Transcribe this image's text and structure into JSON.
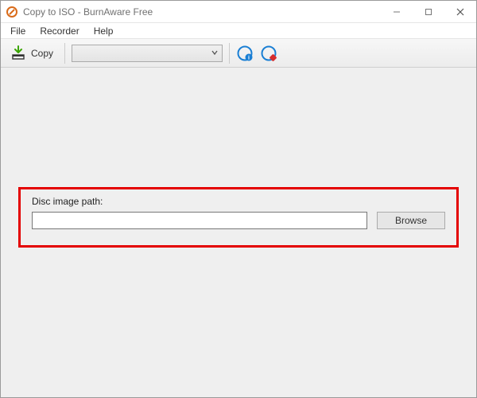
{
  "window": {
    "title": "Copy to ISO - BurnAware Free"
  },
  "menubar": {
    "items": [
      "File",
      "Recorder",
      "Help"
    ]
  },
  "toolbar": {
    "copy_label": "Copy",
    "drive_selected": ""
  },
  "icons": {
    "app": "burnaware-icon",
    "copy": "copy-icon",
    "info": "disc-info-icon",
    "erase": "erase-disc-icon",
    "minimize": "minimize-icon",
    "maximize": "maximize-icon",
    "close": "close-icon",
    "chevron": "chevron-down-icon"
  },
  "panel": {
    "label": "Disc image path:",
    "path_value": "",
    "path_placeholder": "",
    "browse_label": "Browse"
  },
  "colors": {
    "highlight": "#e40000",
    "accent_green": "#3aa500",
    "accent_blue": "#1a7fd4",
    "accent_red": "#d62e2e"
  }
}
